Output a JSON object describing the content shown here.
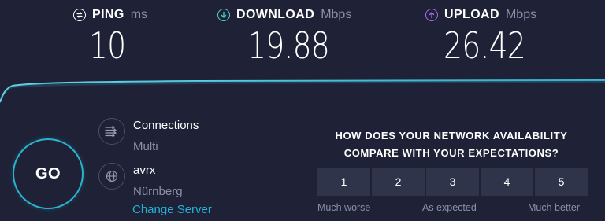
{
  "metrics": {
    "ping": {
      "label": "PING",
      "unit": "ms",
      "value": "10",
      "icon": "ping-icon",
      "color": "#ffffff"
    },
    "download": {
      "label": "DOWNLOAD",
      "unit": "Mbps",
      "value": "19.88",
      "icon": "download-arrow-icon",
      "color": "#4ed0c8"
    },
    "upload": {
      "label": "UPLOAD",
      "unit": "Mbps",
      "value": "26.42",
      "icon": "upload-arrow-icon",
      "color": "#a86bf0"
    }
  },
  "go_button": {
    "label": "GO"
  },
  "connections": {
    "title": "Connections",
    "value": "Multi",
    "icon": "connections-icon"
  },
  "server": {
    "name": "avrx",
    "location": "Nürnberg",
    "change_label": "Change Server",
    "icon": "globe-icon"
  },
  "survey": {
    "question": "HOW DOES YOUR NETWORK AVAILABILITY COMPARE WITH YOUR EXPECTATIONS?",
    "options": [
      "1",
      "2",
      "3",
      "4",
      "5"
    ],
    "low_label": "Much worse",
    "mid_label": "As expected",
    "high_label": "Much better"
  },
  "colors": {
    "background": "#1f2236",
    "accent": "#1fb3d9",
    "graph_line": "#44c3da",
    "muted_text": "#8b8fa8"
  }
}
